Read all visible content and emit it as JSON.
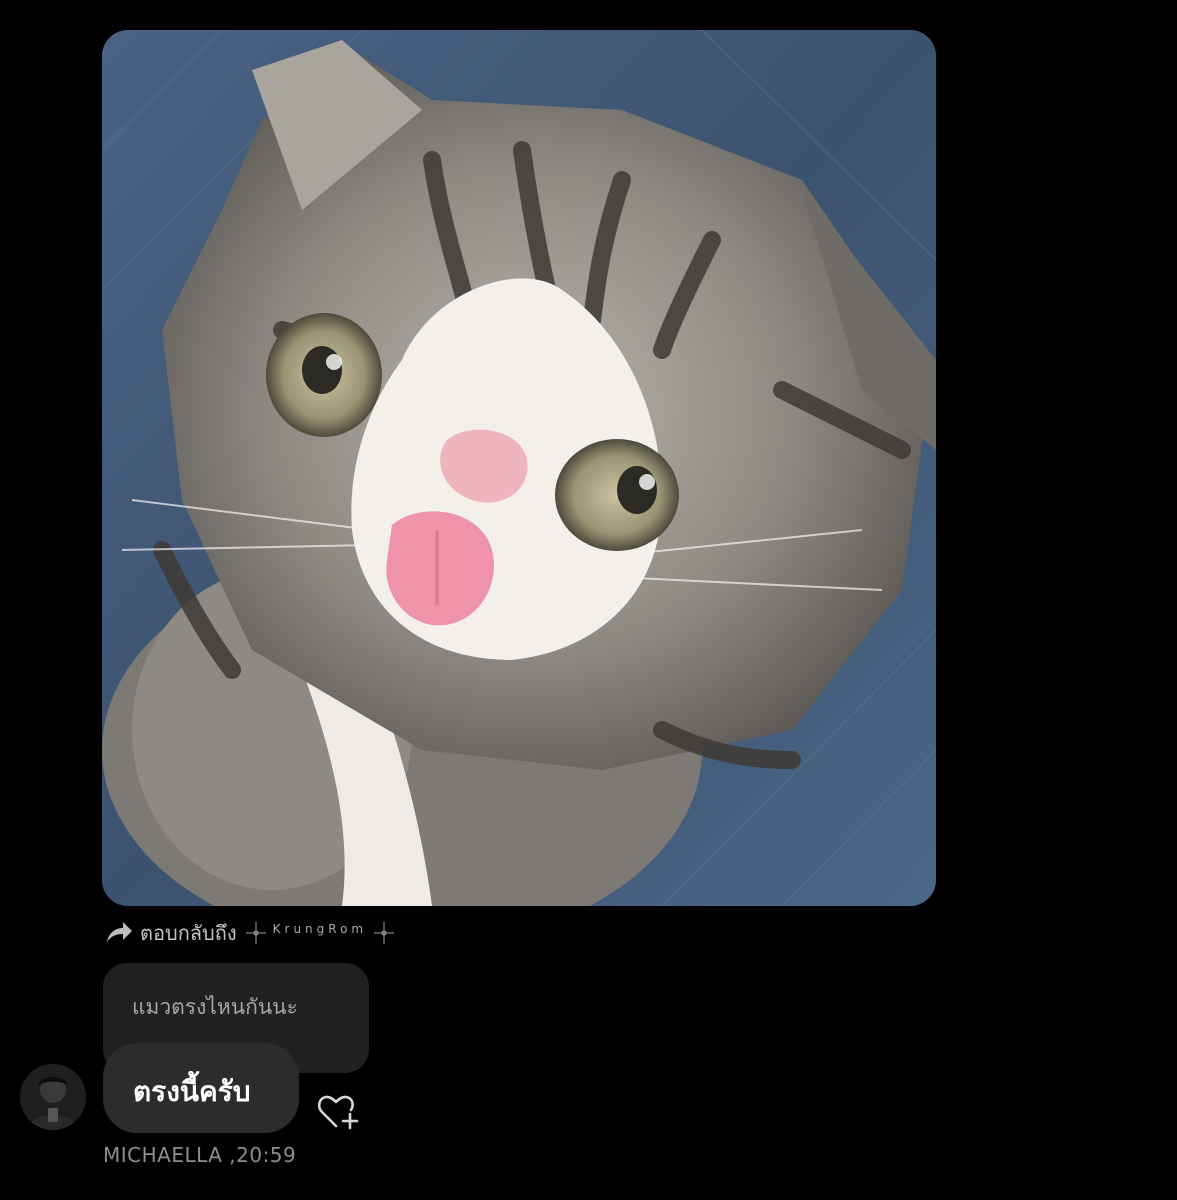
{
  "photo": {
    "icon": "kitten-photo",
    "colors": {
      "background": "#3d5472",
      "fur": "#8c8a86",
      "stripes": "#3f3a35",
      "white": "#f2efec",
      "tongue": "#ee93aa",
      "nose": "#eeb5bd",
      "eyes": "#a29c7b"
    }
  },
  "reply": {
    "icon": "reply-arrow-icon",
    "label": "ตอบกลับถึง",
    "name": "KrungRom"
  },
  "quoted_message": {
    "text": "แมวตรงไหนกันนะ"
  },
  "message": {
    "text": "ตรงนี้ครับ",
    "reaction_icon": "heart-plus-icon"
  },
  "footer": {
    "sender": "MICHAELLA",
    "time": " ,20:59"
  },
  "colors": {
    "page_background": "#000000",
    "quoted_bubble": "#212121",
    "message_bubble": "#2c2c2c",
    "meta_text": "#8e8e8e"
  }
}
